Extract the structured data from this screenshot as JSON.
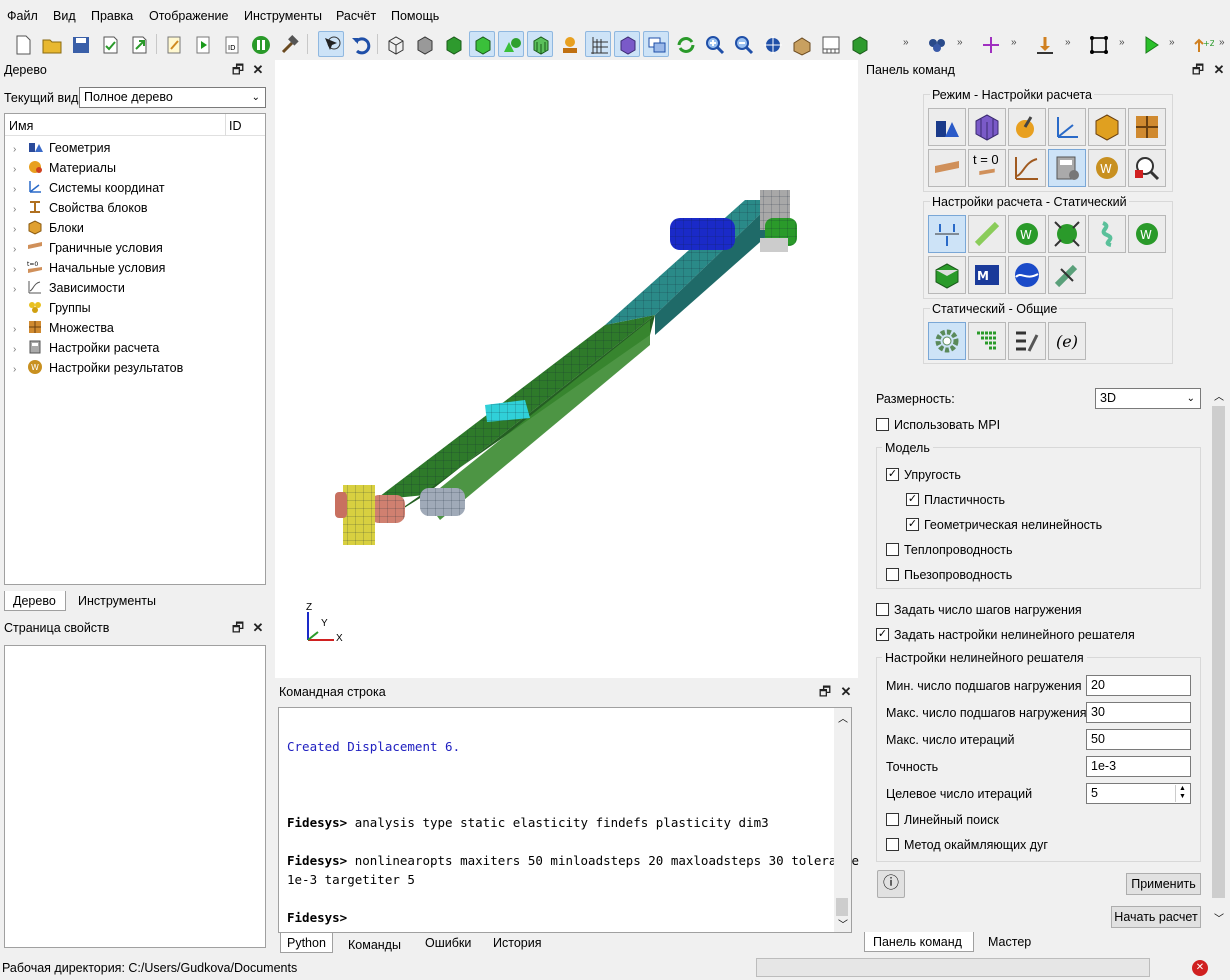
{
  "menu": [
    "Файл",
    "Вид",
    "Правка",
    "Отображение",
    "Инструменты",
    "Расчёт",
    "Помощь"
  ],
  "tree_panel": {
    "title": "Дерево",
    "view_label": "Текущий вид",
    "view_value": "Полное дерево",
    "col_name": "Имя",
    "col_id": "ID",
    "items": [
      "Геометрия",
      "Материалы",
      "Системы координат",
      "Свойства блоков",
      "Блоки",
      "Граничные условия",
      "Начальные условия",
      "Зависимости",
      "Группы",
      "Множества",
      "Настройки расчета",
      "Настройки результатов"
    ],
    "tabs": [
      "Дерево",
      "Инструменты"
    ]
  },
  "props_panel": {
    "title": "Страница свойств"
  },
  "viewport": {
    "axes": {
      "x": "X",
      "y": "Y",
      "z": "Z"
    }
  },
  "console": {
    "title": "Командная строка",
    "lines": [
      {
        "prompt": "",
        "text": "Created Displacement 6."
      },
      {
        "prompt": "Fidesys>",
        "text": "analysis type static elasticity findefs plasticity dim3"
      },
      {
        "prompt": "Fidesys>",
        "text": "nonlinearopts maxiters 50 minloadsteps 20 maxloadsteps 30 tolerance"
      },
      {
        "prompt": "",
        "text": "1e-3 targetiter 5"
      },
      {
        "prompt": "Fidesys>",
        "text": ""
      }
    ],
    "tabs": [
      "Python",
      "Команды",
      "Ошибки",
      "История"
    ]
  },
  "command_panel": {
    "title": "Панель команд",
    "group1_title": "Режим - Настройки расчета",
    "group2_title": "Настройки расчета - Статический",
    "group3_title": "Статический - Общие",
    "t0_label": "t = 0",
    "dimension_label": "Размерность:",
    "dimension_value": "3D",
    "use_mpi": "Использовать MPI",
    "model_group": "Модель",
    "elasticity": "Упругость",
    "plasticity": "Пластичность",
    "geom_nonlin": "Геометрическая нелинейность",
    "heat": "Теплопроводность",
    "piezo": "Пьезопроводность",
    "set_steps": "Задать число шагов нагружения",
    "set_solver": "Задать настройки нелинейного решателя",
    "solver_group": "Настройки нелинейного решателя",
    "min_substeps_label": "Мин. число подшагов нагружения",
    "min_substeps": "20",
    "max_substeps_label": "Макс. число подшагов нагружения",
    "max_substeps": "30",
    "max_iter_label": "Макс. число итераций",
    "max_iter": "50",
    "tolerance_label": "Точность",
    "tolerance": "1e-3",
    "target_iter_label": "Целевое число итераций",
    "target_iter": "5",
    "line_search": "Линейный поиск",
    "arc_length": "Метод окаймляющих дуг",
    "apply": "Применить",
    "start": "Начать расчет",
    "tabs": [
      "Панель команд",
      "Мастер"
    ]
  },
  "status": {
    "workdir": "Рабочая директория: C:/Users/Gudkova/Documents"
  },
  "colors": {
    "accent": "#cde3f7",
    "beam_dark": "#2e6e2a",
    "beam_teal": "#2c8a8a",
    "console_blue": "#2020c0"
  }
}
